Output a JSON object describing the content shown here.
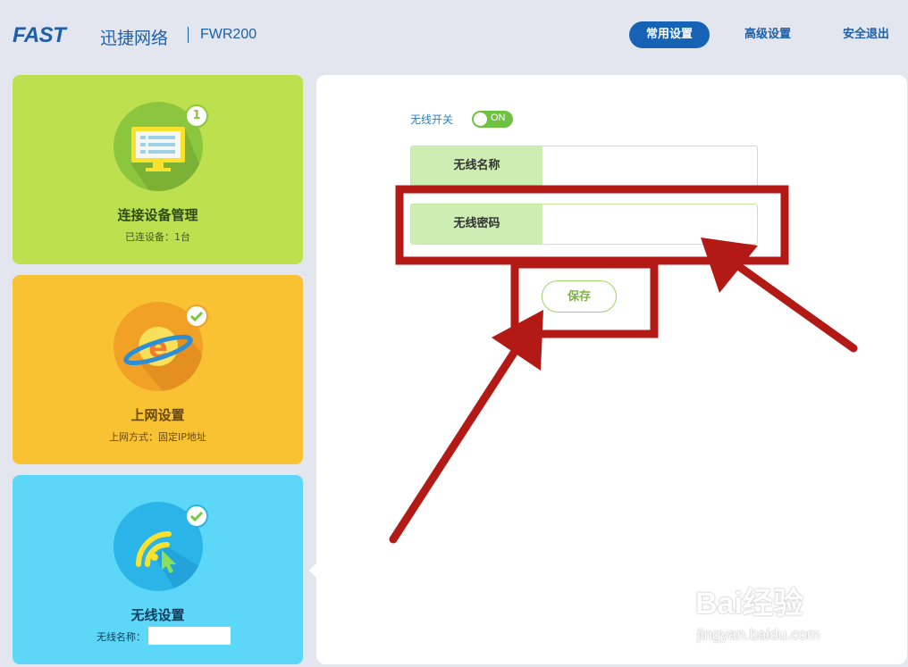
{
  "header": {
    "brand": "FAST",
    "brand_cn": "迅捷网络",
    "model": "FWR200",
    "nav": [
      "常用设置",
      "高级设置",
      "安全退出"
    ]
  },
  "cards": [
    {
      "title": "连接设备管理",
      "subtitle": "已连设备：1台",
      "badge": "1",
      "color": "#bde04f",
      "icon": "monitor-icon"
    },
    {
      "title": "上网设置",
      "subtitle": "上网方式：固定IP地址",
      "badge_icon": "check-icon",
      "color": "#f8c232",
      "icon": "internet-explorer-icon"
    },
    {
      "title": "无线设置",
      "subtitle_label": "无线名称：",
      "subtitle_value": "",
      "badge_icon": "check-icon",
      "color": "#5cd7f8",
      "icon": "wifi-cursor-icon"
    }
  ],
  "wireless": {
    "switch_label": "无线开关",
    "switch_state": "ON",
    "ssid_label": "无线名称",
    "ssid_value": "",
    "password_label": "无线密码",
    "password_value": "",
    "save_label": "保存"
  },
  "watermark": {
    "text": "Bai经验",
    "url": "jingyan.baidu.com"
  },
  "colors": {
    "brand_blue": "#1662b4",
    "annotation_red": "#b31a16"
  }
}
